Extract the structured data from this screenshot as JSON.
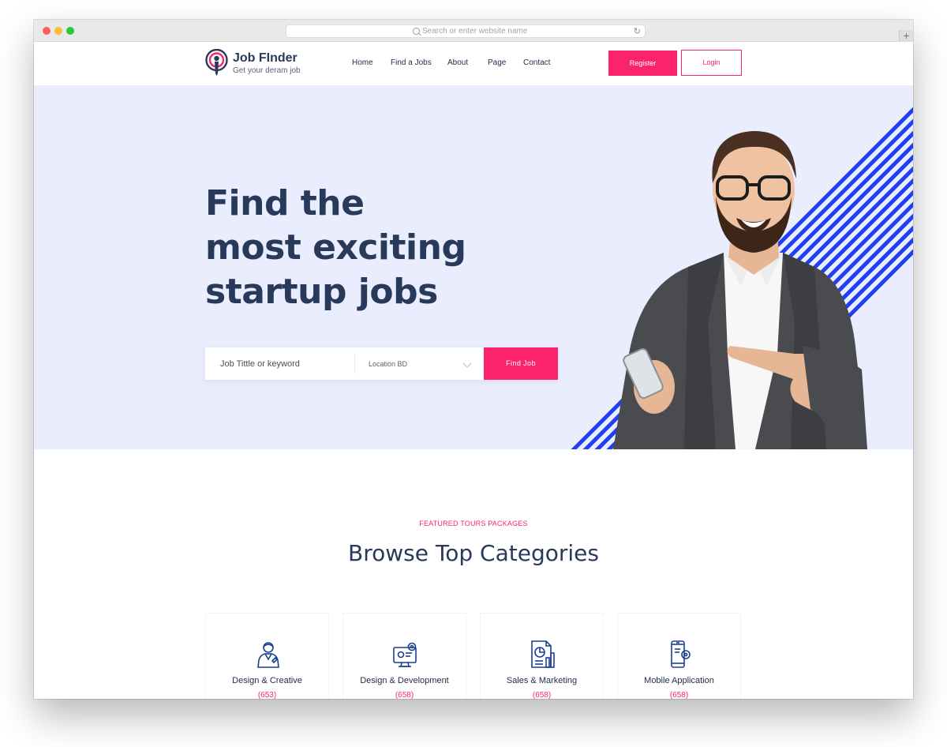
{
  "browser": {
    "address_placeholder": "Search or enter website name",
    "reload_icon": "reload-icon"
  },
  "brand": {
    "name": "Job FInder",
    "tagline": "Get your deram job",
    "accent_color": "#fb246a",
    "navy_color": "#28395a",
    "stripe_color": "#1f3ff0"
  },
  "nav": {
    "items": [
      "Home",
      "Find a Jobs",
      "About",
      "Page",
      "Contact"
    ],
    "register_label": "Register",
    "login_label": "Login"
  },
  "hero": {
    "title_lines": [
      "Find the",
      "most exciting",
      "startup jobs"
    ],
    "search_placeholder": "Job Tittle or keyword",
    "location_label": "Location BD",
    "find_label": "Find Job"
  },
  "categories": {
    "tag": "FEATURED TOURS PACKAGES",
    "title": "Browse Top Categories",
    "items": [
      {
        "name": "Design & Creative",
        "count": "(653)",
        "icon": "designer-icon"
      },
      {
        "name": "Design & Development",
        "count": "(658)",
        "icon": "monitor-gear-icon"
      },
      {
        "name": "Sales & Marketing",
        "count": "(658)",
        "icon": "report-chart-icon"
      },
      {
        "name": "Mobile Application",
        "count": "(658)",
        "icon": "phone-gear-icon"
      }
    ]
  }
}
